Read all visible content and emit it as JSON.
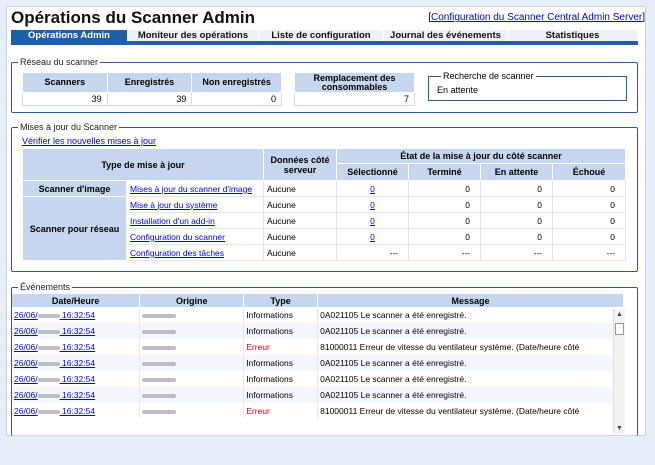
{
  "title": "Opérations du Scanner Admin",
  "top_link": "Configuration du Scanner Central Admin Server",
  "tabs": [
    "Opérations Admin",
    "Moniteur des opérations",
    "Liste de configuration",
    "Journal des événements",
    "Statistiques"
  ],
  "network": {
    "legend": "Réseau du scanner",
    "headers": [
      "Scanners",
      "Enregistrés",
      "Non enregistrés",
      "Remplacement des consommables"
    ],
    "values": [
      "39",
      "39",
      "0",
      "7"
    ],
    "search_label": "Recherche de scanner",
    "search_value": "En attente"
  },
  "updates": {
    "legend": "Mises à jour du Scanner",
    "check_link": "Vérifier les nouvelles mises à jour",
    "h_type": "Type de mise à jour",
    "h_server": "Données côté serveur",
    "h_state": "État de la mise à jour du côté scanner",
    "h_cols": [
      "Sélectionné",
      "Terminé",
      "En attente",
      "Échoué"
    ],
    "group1": "Scanner d'image",
    "group2": "Scanner pour réseau",
    "rows": [
      {
        "label": "Mises à jour du scanner d'image",
        "server": "Aucune",
        "sel": "0",
        "done": "0",
        "wait": "0",
        "fail": "0"
      },
      {
        "label": "Mise à jour du système",
        "server": "Aucune",
        "sel": "0",
        "done": "0",
        "wait": "0",
        "fail": "0"
      },
      {
        "label": "Installation d'un add-in",
        "server": "Aucune",
        "sel": "0",
        "done": "0",
        "wait": "0",
        "fail": "0"
      },
      {
        "label": "Configuration du scanner",
        "server": "Aucune",
        "sel": "0",
        "done": "0",
        "wait": "0",
        "fail": "0"
      },
      {
        "label": "Configuration des tâches",
        "server": "Aucune",
        "sel": "---",
        "done": "---",
        "wait": "---",
        "fail": "---"
      }
    ]
  },
  "events": {
    "legend": "Événements",
    "headers": [
      "Date/Heure",
      "Origine",
      "Type",
      "Message"
    ],
    "rows": [
      {
        "date": "26/06/",
        "time": "16:32:54",
        "type": "Informations",
        "error": false,
        "msg": "0A021105  Le scanner a été enregistré."
      },
      {
        "date": "26/06/",
        "time": "16:32:54",
        "type": "Informations",
        "error": false,
        "msg": "0A021105  Le scanner a été enregistré."
      },
      {
        "date": "26/06/",
        "time": "16:32:54",
        "type": "Erreur",
        "error": true,
        "msg": "81000011  Erreur de vitesse du ventilateur système. (Date/heure côté"
      },
      {
        "date": "26/06/",
        "time": "16:32:54",
        "type": "Informations",
        "error": false,
        "msg": "0A021105  Le scanner a été enregistré."
      },
      {
        "date": "26/06/",
        "time": "16:32:54",
        "type": "Informations",
        "error": false,
        "msg": "0A021105  Le scanner a été enregistré."
      },
      {
        "date": "26/06/",
        "time": "16:32:54",
        "type": "Informations",
        "error": false,
        "msg": "0A021105  Le scanner a été enregistré."
      },
      {
        "date": "26/06/",
        "time": "16:32:54",
        "type": "Erreur",
        "error": true,
        "msg": "81000011  Erreur de vitesse du ventilateur système. (Date/heure côté"
      }
    ]
  },
  "colors": {
    "accent": "#1d5fa8",
    "header_bg": "#c6d6ee",
    "error": "#e00000"
  }
}
